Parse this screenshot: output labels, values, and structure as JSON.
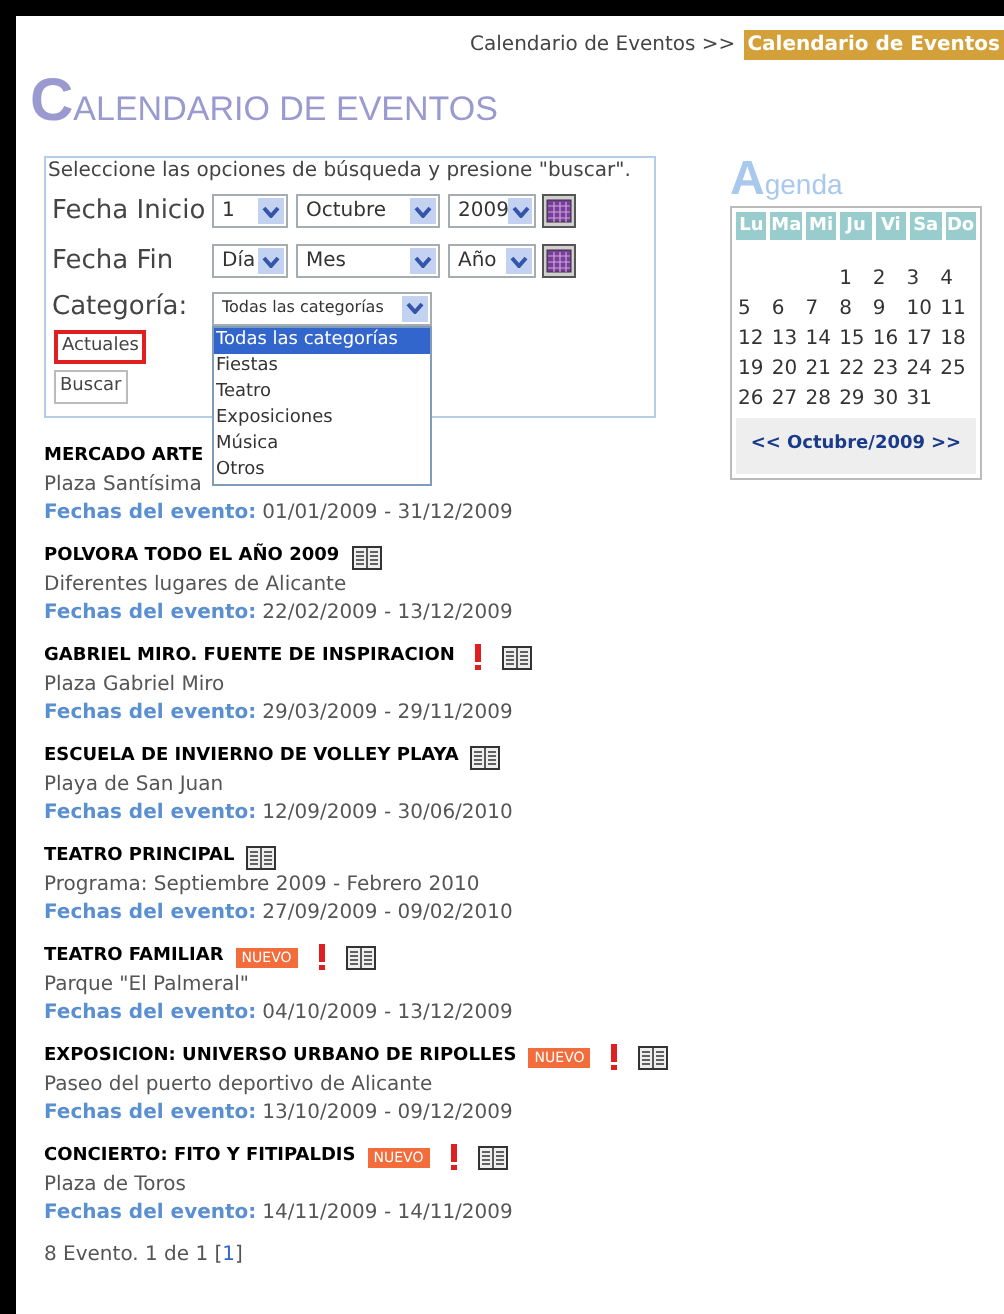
{
  "breadcrumb": {
    "parent": "Calendario de Eventos >>",
    "current": "Calendario de Eventos"
  },
  "title": {
    "initial": "C",
    "rest": "ALENDARIO DE EVENTOS"
  },
  "search": {
    "instructions": "Seleccione las opciones de búsqueda y presione \"buscar\".",
    "rows": [
      {
        "label": "Fecha Inicio",
        "day": "1",
        "month": "Octubre",
        "year": "2009"
      },
      {
        "label": "Fecha Fin",
        "day": "Día",
        "month": "Mes",
        "year": "Año"
      }
    ],
    "category": {
      "label": "Categoría:",
      "value": "Todas las categorías",
      "expanded": true,
      "options": [
        {
          "label": "Todas las categorías",
          "selected": true
        },
        {
          "label": "Fiestas",
          "selected": false
        },
        {
          "label": "Teatro",
          "selected": false
        },
        {
          "label": "Exposiciones",
          "selected": false
        },
        {
          "label": "Música",
          "selected": false
        },
        {
          "label": "Otros",
          "selected": false
        }
      ]
    },
    "buttons": [
      {
        "label": "Actuales",
        "highlighted": true
      },
      {
        "label": "Buscar",
        "highlighted": false
      }
    ]
  },
  "events": [
    {
      "name": "MERCADO ARTE",
      "new": false,
      "alert": false,
      "book": false,
      "place": "Plaza Santísima",
      "dates_label": "Fechas del evento:",
      "dates": "01/01/2009 - 31/12/2009"
    },
    {
      "name": "POLVORA TODO EL AÑO 2009",
      "new": false,
      "alert": false,
      "book": true,
      "place": "Diferentes lugares de Alicante",
      "dates_label": "Fechas del evento:",
      "dates": "22/02/2009 - 13/12/2009"
    },
    {
      "name": "GABRIEL MIRO. FUENTE DE INSPIRACION",
      "new": false,
      "alert": true,
      "book": true,
      "place": "Plaza Gabriel Miro",
      "dates_label": "Fechas del evento:",
      "dates": "29/03/2009 - 29/11/2009"
    },
    {
      "name": "ESCUELA DE INVIERNO DE VOLLEY PLAYA",
      "new": false,
      "alert": false,
      "book": true,
      "place": "Playa de San Juan",
      "dates_label": "Fechas del evento:",
      "dates": "12/09/2009 - 30/06/2010"
    },
    {
      "name": "TEATRO PRINCIPAL",
      "new": false,
      "alert": false,
      "book": true,
      "place": "Programa: Septiembre 2009 - Febrero 2010",
      "dates_label": "Fechas del evento:",
      "dates": "27/09/2009 - 09/02/2010"
    },
    {
      "name": "TEATRO FAMILIAR",
      "new": true,
      "new_label": "NUEVO",
      "alert": true,
      "book": true,
      "place": "Parque \"El Palmeral\"",
      "dates_label": "Fechas del evento:",
      "dates": "04/10/2009 - 13/12/2009"
    },
    {
      "name": "EXPOSICION: UNIVERSO URBANO DE RIPOLLES",
      "new": true,
      "new_label": "NUEVO",
      "alert": true,
      "book": true,
      "place": "Paseo del puerto deportivo de Alicante",
      "dates_label": "Fechas del evento:",
      "dates": "13/10/2009 - 09/12/2009"
    },
    {
      "name": "CONCIERTO: FITO Y FITIPALDIS",
      "new": true,
      "new_label": "NUEVO",
      "alert": true,
      "book": true,
      "place": "Plaza de Toros",
      "dates_label": "Fechas del evento:",
      "dates": "14/11/2009 - 14/11/2009"
    }
  ],
  "pagination": {
    "summary": "8 Evento. 1 de 1 [",
    "page": "1",
    "close": "]"
  },
  "agenda": {
    "title_initial": "A",
    "title_rest": "genda",
    "weekdays": [
      "Lu",
      "Ma",
      "Mi",
      "Ju",
      "Vi",
      "Sa",
      "Do"
    ],
    "weeks": [
      [
        "1",
        "2",
        "3",
        "4"
      ],
      [
        "5",
        "6",
        "7",
        "8",
        "9",
        "10",
        "11"
      ],
      [
        "12",
        "13",
        "14",
        "15",
        "16",
        "17",
        "18"
      ],
      [
        "19",
        "20",
        "21",
        "22",
        "23",
        "24",
        "25"
      ],
      [
        "26",
        "27",
        "28",
        "29",
        "30",
        "31"
      ]
    ],
    "prev": "<<",
    "month": "Octubre/2009",
    "next": ">>"
  }
}
